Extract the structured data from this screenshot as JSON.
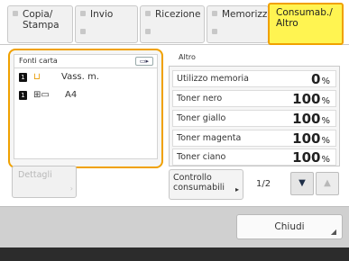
{
  "tabs": [
    {
      "line1": "Copia/",
      "line2": "Stampa",
      "active": false
    },
    {
      "line1": "Invio",
      "line2": "",
      "active": false
    },
    {
      "line1": "Ricezione",
      "line2": "",
      "active": false
    },
    {
      "line1": "Memorizza",
      "line2": "",
      "active": false
    },
    {
      "line1": "Consumab./",
      "line2": "Altro",
      "active": true
    }
  ],
  "paper": {
    "header": "Fonti carta",
    "tools_icon": "paper-settings-icon",
    "trays": [
      {
        "number": "1",
        "icon": "paper-tray-icon",
        "label": "Vass. m."
      },
      {
        "number": "1",
        "icon": "cassette-icon",
        "label": "A4"
      }
    ]
  },
  "altro": {
    "title": "Altro",
    "rows": [
      {
        "label": "Utilizzo memoria",
        "value": "0",
        "unit": "%"
      },
      {
        "label": "Toner nero",
        "value": "100",
        "unit": "%"
      },
      {
        "label": "Toner giallo",
        "value": "100",
        "unit": "%"
      },
      {
        "label": "Toner magenta",
        "value": "100",
        "unit": "%"
      },
      {
        "label": "Toner ciano",
        "value": "100",
        "unit": "%"
      }
    ]
  },
  "dettagli_label": "Dettagli",
  "controllo": {
    "line1": "Controllo",
    "line2": "consumabili"
  },
  "pager": {
    "text": "1/2"
  },
  "close_label": "Chiudi",
  "colors": {
    "accent": "#f0a100",
    "active_tab": "#fff451"
  }
}
